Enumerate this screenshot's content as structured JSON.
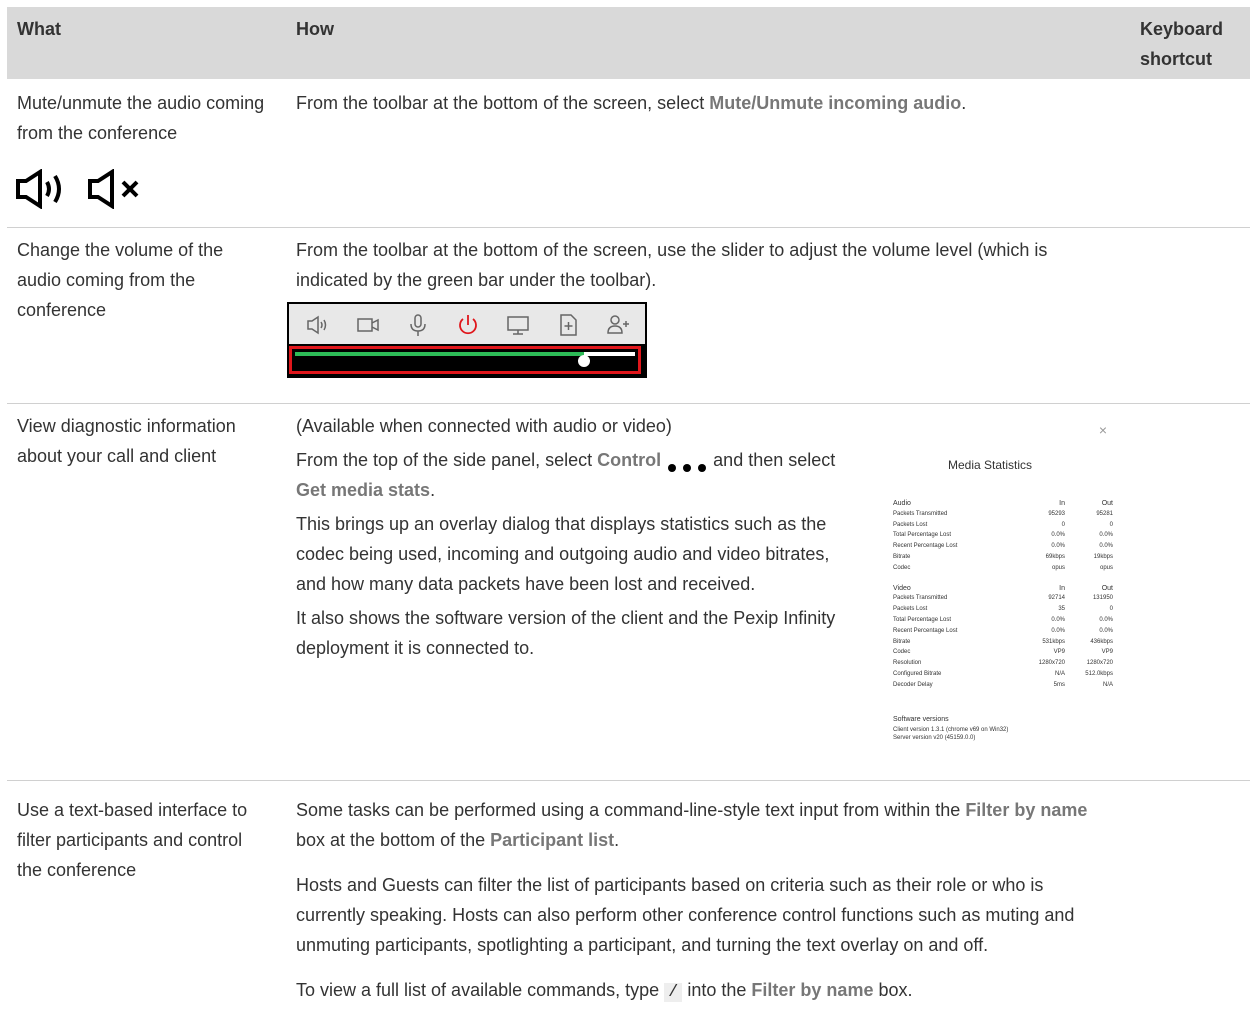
{
  "header": {
    "what": "What",
    "how": "How",
    "shortcut_line1": "Keyboard",
    "shortcut_line2": "shortcut"
  },
  "rows": [
    {
      "what": "Mute/unmute the audio coming from the conference",
      "how_pre": "From the toolbar at the bottom of the screen, select ",
      "how_ui": "Mute/Unmute incoming audio",
      "how_post": ".",
      "icons": [
        "speaker-on-icon",
        "speaker-muted-icon"
      ]
    },
    {
      "what": "Change the volume of the audio coming from the conference",
      "how": "From the toolbar at the bottom of the screen, use the slider to adjust the volume level (which is indicated by the green bar under the toolbar).",
      "toolbar_icons": [
        "speaker-icon",
        "camera-icon",
        "microphone-icon",
        "power-icon",
        "monitor-icon",
        "add-file-icon",
        "add-person-icon"
      ],
      "volume_level": 0.85,
      "accent_red": "#e0161b",
      "volume_green": "#2dbb57"
    },
    {
      "what": "View diagnostic information about your call and client",
      "p1": "(Available when connected with audio or video)",
      "p2_pre": "From the top of the side panel, select ",
      "p2_ui1": "Control",
      "p2_mid": " and then select ",
      "p2_ui2": "Get media stats",
      "p2_post": ".",
      "p3": "This brings up an overlay dialog that displays statistics such as the codec being used, incoming and outgoing audio and video bitrates, and how many data packets have been lost and received.",
      "p4": "It also shows the software version of the client and the Pexip Infinity deployment it is connected to."
    },
    {
      "what": "Use a text-based interface to filter participants and control the conference",
      "p1_pre": "Some tasks can be performed using a command-line-style text input from within the ",
      "p1_ui1": "Filter by name",
      "p1_mid": " box at the bottom of the ",
      "p1_ui2": "Participant list",
      "p1_post": ".",
      "p2": "Hosts and Guests can filter the list of participants based on criteria such as their role or who is currently speaking. Hosts can also perform other conference control functions such as muting and unmuting participants, spotlighting a participant, and turning the text overlay on and off.",
      "p3_pre": "To view a full list of available commands, type ",
      "p3_code": "/",
      "p3_mid": " into the ",
      "p3_ui": "Filter by name",
      "p3_post": " box."
    }
  ],
  "media_stats": {
    "title": "Media Statistics",
    "close": "×",
    "audio_header": [
      "Audio",
      "In",
      "Out"
    ],
    "audio": [
      [
        "Packets Transmitted",
        "95293",
        "95281"
      ],
      [
        "Packets Lost",
        "0",
        "0"
      ],
      [
        "Total Percentage Lost",
        "0.0%",
        "0.0%"
      ],
      [
        "Recent Percentage Lost",
        "0.0%",
        "0.0%"
      ],
      [
        "Bitrate",
        "69kbps",
        "19kbps"
      ],
      [
        "Codec",
        "opus",
        "opus"
      ]
    ],
    "video_header": [
      "Video",
      "In",
      "Out"
    ],
    "video": [
      [
        "Packets Transmitted",
        "92714",
        "131950"
      ],
      [
        "Packets Lost",
        "35",
        "0"
      ],
      [
        "Total Percentage Lost",
        "0.0%",
        "0.0%"
      ],
      [
        "Recent Percentage Lost",
        "0.0%",
        "0.0%"
      ],
      [
        "Bitrate",
        "531kbps",
        "436kbps"
      ],
      [
        "Codec",
        "VP9",
        "VP9"
      ],
      [
        "Resolution",
        "1280x720",
        "1280x720"
      ],
      [
        "Configured Bitrate",
        "N/A",
        "512.0kbps"
      ],
      [
        "Decoder Delay",
        "5ms",
        "N/A"
      ]
    ],
    "software_title": "Software versions",
    "client_version": "Client version 1.3.1 (chrome v69 on Win32)",
    "server_version": "Server version v20 (45159.0.0)"
  }
}
